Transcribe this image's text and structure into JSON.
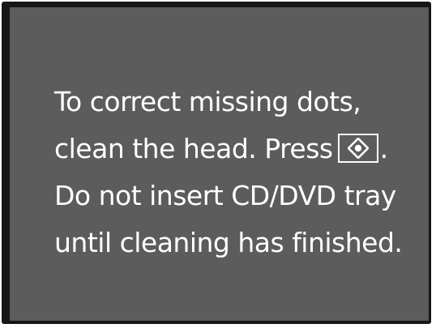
{
  "message": {
    "line1": "To correct missing dots,",
    "line2_before_icon": "clean the head. Press",
    "line2_after_icon": ".",
    "line3": "Do not insert CD/DVD tray",
    "line4": "until cleaning has finished.",
    "inline_icon": "start-button-icon"
  },
  "colors": {
    "screen_background": "#5c5c5c",
    "frame": "#161616",
    "text": "#ffffff"
  }
}
